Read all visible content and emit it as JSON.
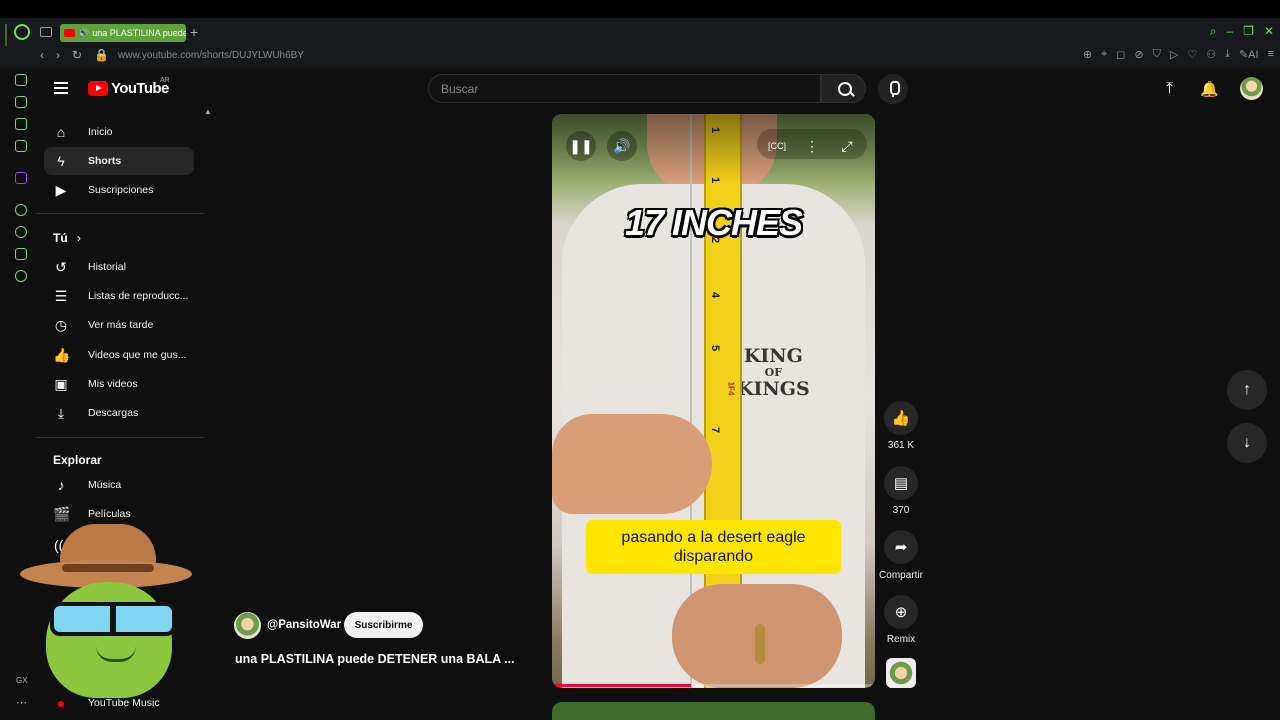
{
  "browser": {
    "tab_title": "una PLASTILINA puede",
    "url_domain": "www.youtube.com",
    "url_path": "/shorts/DUJYLWUh6BY",
    "ai_label": "AI",
    "gx_label": "GX",
    "accent_color": "#6ee05a"
  },
  "header": {
    "logo_text": "YouTube",
    "country": "AR",
    "search_placeholder": "Buscar"
  },
  "sidebar": {
    "main": [
      {
        "label": "Inicio",
        "icon": "home-icon"
      },
      {
        "label": "Shorts",
        "icon": "shorts-icon",
        "active": true
      },
      {
        "label": "Suscripciones",
        "icon": "subscriptions-icon"
      }
    ],
    "you_heading": "Tú",
    "you_items": [
      {
        "label": "Historial",
        "icon": "history-icon"
      },
      {
        "label": "Listas de reproducc...",
        "icon": "playlist-icon"
      },
      {
        "label": "Ver más tarde",
        "icon": "clock-icon"
      },
      {
        "label": "Videos que me gus...",
        "icon": "like-icon"
      },
      {
        "label": "Mis videos",
        "icon": "my-videos-icon"
      },
      {
        "label": "Descargas",
        "icon": "download-icon"
      }
    ],
    "explore_heading": "Explorar",
    "explore_items": [
      {
        "label": "Música",
        "icon": "music-icon"
      },
      {
        "label": "Películas",
        "icon": "movies-icon"
      }
    ],
    "bottom_item": {
      "label": "YouTube Music",
      "icon": "youtube-music-icon"
    }
  },
  "short": {
    "overlay_text": "17 INCHES",
    "caption": "pasando a la desert eagle disparando",
    "shirt_text_1": "KING",
    "shirt_text_2": "OF",
    "shirt_text_3": "KINGS",
    "progress_percent": 43,
    "channel": "@PansitoWar",
    "subscribe_label": "Suscribirme",
    "title": "una PLASTILINA puede DETENER una BALA ...",
    "likes": "361 K",
    "comments": "370",
    "share_label": "Compartir",
    "remix_label": "Remix"
  }
}
